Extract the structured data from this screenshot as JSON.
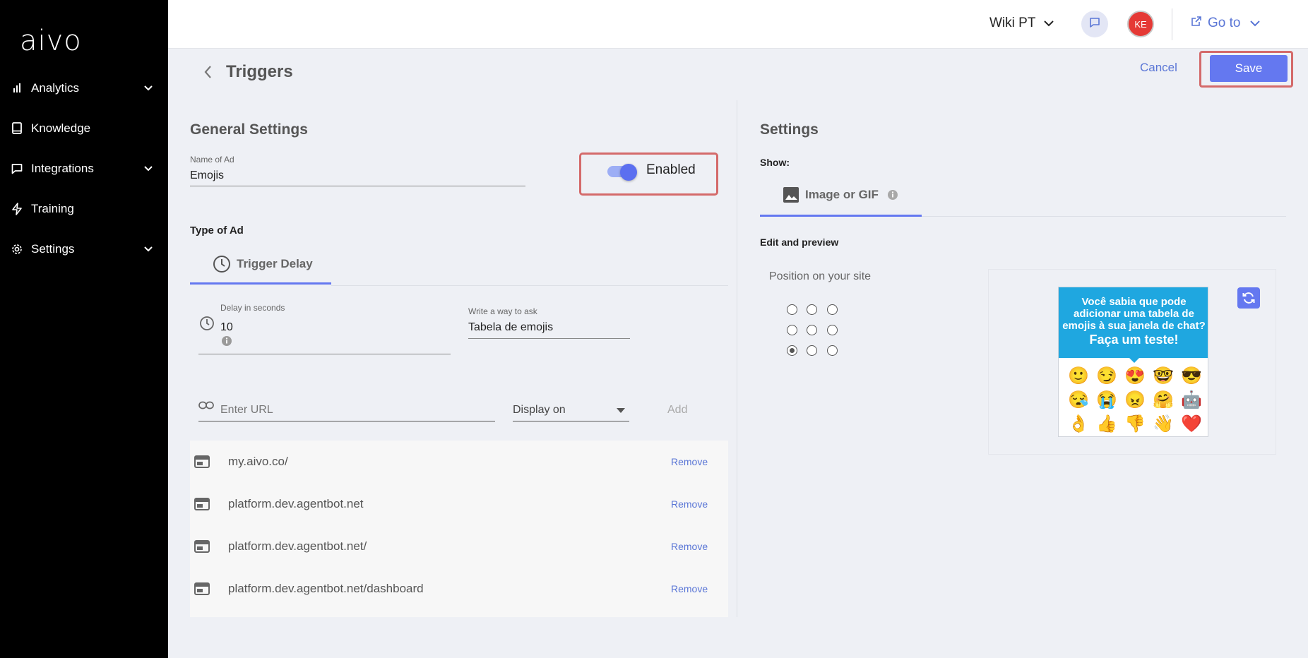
{
  "sidebar": {
    "logo": "aivo",
    "items": [
      {
        "label": "Analytics",
        "icon": "bar-chart-icon",
        "has_submenu": true
      },
      {
        "label": "Knowledge",
        "icon": "book-icon",
        "has_submenu": false
      },
      {
        "label": "Integrations",
        "icon": "chat-bubble-icon",
        "has_submenu": true
      },
      {
        "label": "Training",
        "icon": "lightning-icon",
        "has_submenu": false
      },
      {
        "label": "Settings",
        "icon": "gear-icon",
        "has_submenu": true
      }
    ]
  },
  "topbar": {
    "workspace": "Wiki PT",
    "avatar_initials": "KE",
    "goto_label": "Go to"
  },
  "header": {
    "title": "Triggers",
    "cancel_label": "Cancel",
    "save_label": "Save"
  },
  "general": {
    "title": "General Settings",
    "name_label": "Name of Ad",
    "name_value": "Emojis",
    "enabled_label": "Enabled",
    "enabled": true,
    "type_label": "Type of Ad",
    "type_tab": "Trigger Delay",
    "delay_label": "Delay in seconds",
    "delay_value": "10",
    "ask_label": "Write a way to ask",
    "ask_value": "Tabela de emojis",
    "url_placeholder": "Enter URL",
    "display_on": "Display on",
    "add_label": "Add",
    "remove_label": "Remove",
    "urls": [
      "my.aivo.co/",
      "platform.dev.agentbot.net",
      "platform.dev.agentbot.net/",
      "platform.dev.agentbot.net/dashboard"
    ]
  },
  "settings": {
    "title": "Settings",
    "show_label": "Show:",
    "show_tab": "Image or GIF",
    "edit_label": "Edit and preview",
    "position_label": "Position on your site",
    "selected_position": "bottom-left",
    "ad": {
      "line1": "Você sabia que pode",
      "line2": "adicionar uma tabela de",
      "line3": "emojis à sua janela de chat?",
      "line4": "Faça um teste!",
      "emojis": [
        "🙂",
        "😏",
        "😍",
        "🤓",
        "😎",
        "😪",
        "😭",
        "😠",
        "🤗",
        "🤖",
        "👌",
        "👍",
        "👎",
        "👋",
        "❤️"
      ]
    }
  },
  "colors": {
    "accent": "#6478f0",
    "link": "#5a76d6",
    "highlight": "#d46a6a",
    "sidebar_bg": "#000000",
    "ad_blue": "#1fa7e0"
  }
}
